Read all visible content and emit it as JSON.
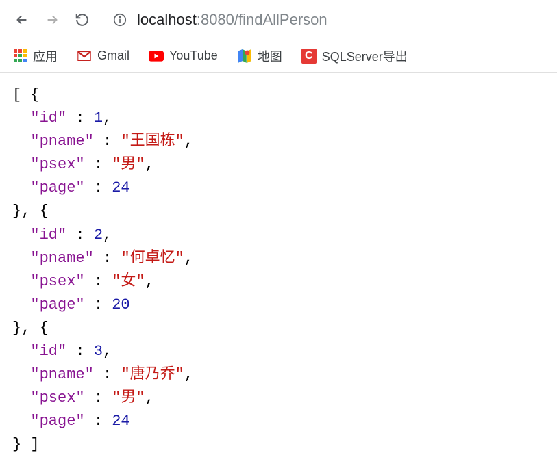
{
  "url": {
    "host": "localhost",
    "port_path": ":8080/findAllPerson"
  },
  "bookmarks": {
    "apps": "应用",
    "gmail": "Gmail",
    "youtube": "YouTube",
    "maps": "地图",
    "sqlserver": "SQLServer导出"
  },
  "json_response": [
    {
      "id": 1,
      "pname": "王国栋",
      "psex": "男",
      "page": 24
    },
    {
      "id": 2,
      "pname": "何卓忆",
      "psex": "女",
      "page": 20
    },
    {
      "id": 3,
      "pname": "唐乃乔",
      "psex": "男",
      "page": 24
    }
  ]
}
